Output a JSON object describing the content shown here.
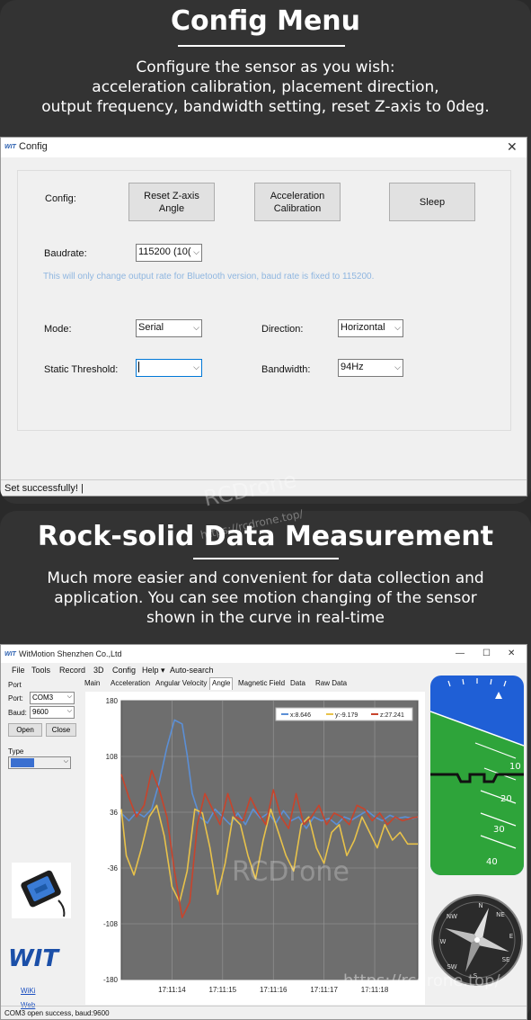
{
  "section1": {
    "heading": "Config Menu",
    "description": [
      "Configure the sensor as you wish:",
      "acceleration calibration, placement direction,",
      "output frequency, bandwidth setting, reset Z-axis to 0deg."
    ]
  },
  "config_window": {
    "title": "Config",
    "close_glyph": "✕",
    "config_label": "Config:",
    "buttons": {
      "reset_z": [
        "Reset Z-axis",
        "Angle"
      ],
      "acc_cal": [
        "Acceleration",
        "Calibration"
      ],
      "sleep": "Sleep"
    },
    "baudrate_label": "Baudrate:",
    "baudrate_value": "115200 (10(",
    "hint": "This will only change output rate for Bluetooth version, baud rate is fixed to 115200.",
    "mode_label": "Mode:",
    "mode_value": "Serial",
    "direction_label": "Direction:",
    "direction_value": "Horizontal",
    "threshold_label": "Static Threshold:",
    "threshold_value": "",
    "bandwidth_label": "Bandwidth:",
    "bandwidth_value": "94Hz",
    "status": "Set successfully!   |"
  },
  "section2": {
    "heading": "Rock-solid Data Measurement",
    "description": [
      "Much more easier and convenient for data collection and",
      "application. You can see motion changing of  the sensor",
      "shown in the curve in real-time"
    ]
  },
  "watermarks": {
    "brand": "RCDrone",
    "url": "https://rcdrone.top/"
  },
  "wit_window": {
    "title": "WitMotion Shenzhen Co.,Ltd",
    "controls": [
      "—",
      "☐",
      "✕"
    ],
    "menu": [
      "File",
      "Tools",
      "Record",
      "3D",
      "Config",
      "Help ▾",
      "Auto-search"
    ],
    "port_group": "Port",
    "port_label": "Port:",
    "port_value": "COM3",
    "baud_label": "Baud:",
    "baud_value": "9600",
    "open_button": "Open",
    "close_button": "Close",
    "type_label": "Type",
    "type_value": "",
    "logo_text": "WIT",
    "links": [
      "WiKi",
      "Web"
    ],
    "tabs": [
      "Main",
      "Acceleration",
      "Angular Velocity",
      "Angle",
      "Magnetic Field",
      "Data",
      "Raw Data"
    ],
    "active_tab": "Angle",
    "status": "COM3 open success, baud:9600",
    "horizon_ticks": [
      "10",
      "20",
      "30",
      "40"
    ],
    "compass_marks": [
      "N",
      "NE",
      "E",
      "SE",
      "S",
      "SW",
      "W",
      "NW"
    ]
  },
  "chart_data": {
    "type": "line",
    "title": "",
    "xlabel": "",
    "ylabel": "",
    "ylim": [
      -180,
      180
    ],
    "yticks": [
      180,
      108,
      36,
      -36,
      -108,
      -180
    ],
    "xticks": [
      "17:11:14",
      "17:11:15",
      "17:11:16",
      "17:11:17",
      "17:11:18"
    ],
    "xlim": [
      13.0,
      18.85
    ],
    "xtick_positions": [
      14,
      15,
      16,
      17,
      18
    ],
    "legend_position": "top-right",
    "colors": {
      "x": "#5b8fd6",
      "y": "#e8c24a",
      "z": "#c8442c",
      "plot_bg": "#6e6e6e",
      "grid": "#999999"
    },
    "legend": [
      "x:8.646",
      "y:-9.179",
      "z:27.241"
    ],
    "series": [
      {
        "name": "x:8.646",
        "key": "x",
        "x": [
          13.0,
          13.15,
          13.3,
          13.45,
          13.6,
          13.75,
          13.9,
          14.05,
          14.2,
          14.3,
          14.4,
          14.55,
          14.7,
          14.85,
          15.0,
          15.15,
          15.3,
          15.45,
          15.6,
          15.75,
          15.9,
          16.05,
          16.2,
          16.35,
          16.5,
          16.65,
          16.8,
          16.95,
          17.1,
          17.25,
          17.4,
          17.55,
          17.7,
          17.85,
          18.0,
          18.15,
          18.3,
          18.45,
          18.6,
          18.75,
          18.85
        ],
        "y": [
          35,
          25,
          36,
          30,
          40,
          75,
          120,
          155,
          150,
          110,
          60,
          30,
          22,
          40,
          30,
          20,
          35,
          20,
          40,
          28,
          35,
          22,
          38,
          25,
          30,
          15,
          30,
          25,
          28,
          20,
          30,
          26,
          32,
          38,
          30,
          25,
          32,
          28,
          30,
          28,
          30
        ]
      },
      {
        "name": "y:-9.179",
        "key": "y",
        "x": [
          13.0,
          13.1,
          13.25,
          13.4,
          13.55,
          13.7,
          13.85,
          14.0,
          14.15,
          14.3,
          14.45,
          14.6,
          14.75,
          14.9,
          15.05,
          15.2,
          15.35,
          15.5,
          15.65,
          15.8,
          15.95,
          16.1,
          16.25,
          16.4,
          16.55,
          16.7,
          16.85,
          17.0,
          17.15,
          17.3,
          17.45,
          17.6,
          17.75,
          17.9,
          18.05,
          18.2,
          18.35,
          18.5,
          18.65,
          18.85
        ],
        "y": [
          40,
          -20,
          -45,
          -10,
          30,
          45,
          5,
          -60,
          -80,
          -40,
          40,
          35,
          -10,
          -70,
          -30,
          30,
          20,
          -20,
          -50,
          0,
          40,
          10,
          -20,
          -40,
          20,
          30,
          -10,
          -30,
          10,
          20,
          -20,
          0,
          30,
          10,
          -10,
          20,
          0,
          10,
          -5,
          -5
        ]
      },
      {
        "name": "z:27.241",
        "key": "z",
        "x": [
          13.0,
          13.15,
          13.3,
          13.45,
          13.6,
          13.75,
          13.9,
          14.05,
          14.2,
          14.35,
          14.5,
          14.65,
          14.8,
          14.95,
          15.1,
          15.25,
          15.4,
          15.55,
          15.7,
          15.85,
          16.0,
          16.15,
          16.3,
          16.45,
          16.6,
          16.75,
          16.9,
          17.05,
          17.2,
          17.35,
          17.5,
          17.65,
          17.8,
          17.95,
          18.1,
          18.25,
          18.4,
          18.55,
          18.7,
          18.85
        ],
        "y": [
          85,
          55,
          30,
          45,
          90,
          65,
          30,
          -40,
          -100,
          -80,
          20,
          60,
          40,
          20,
          60,
          30,
          25,
          55,
          35,
          20,
          65,
          30,
          15,
          60,
          20,
          30,
          45,
          20,
          35,
          30,
          20,
          45,
          40,
          25,
          35,
          20,
          30,
          25,
          28,
          30
        ]
      }
    ]
  }
}
